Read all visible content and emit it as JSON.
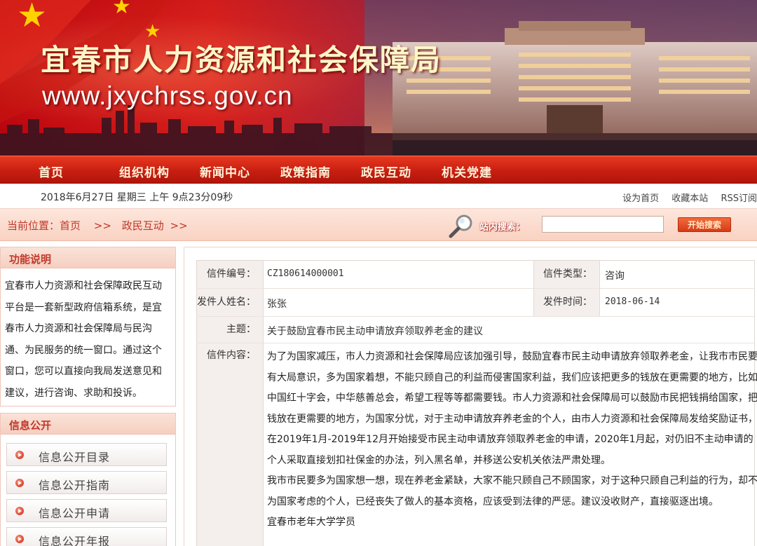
{
  "banner": {
    "title": "宜春市人力资源和社会保障局",
    "url": "www.jxychrss.gov.cn"
  },
  "nav": {
    "items": [
      "首页",
      "组织机构",
      "新闻中心",
      "政策指南",
      "政民互动",
      "机关党建"
    ]
  },
  "datebar": {
    "date": "2018年6月27日 星期三  上午 9点23分09秒",
    "links": [
      "设为首页",
      "收藏本站",
      "RSS订阅"
    ]
  },
  "location": {
    "label": "当前位置：首页",
    "sep1": ">>",
    "section": "政民互动",
    "sep2": ">>",
    "search_label": "站内搜索：",
    "search_value": "",
    "search_button": "开始搜索"
  },
  "sidebar": {
    "func_title": "功能说明",
    "func_text": "宜春市人力资源和社会保障政民互动平台是一套新型政府信箱系统，是宜春市人力资源和社会保障局与民沟通、为民服务的统一窗口。通过这个窗口，您可以直接向我局发送意见和建议，进行咨询、求助和投诉。",
    "info_title": "信息公开",
    "info_items": [
      "信息公开目录",
      "信息公开指南",
      "信息公开申请",
      "信息公开年报"
    ]
  },
  "letter": {
    "id_label": "信件编号：",
    "id": "CZ180614000001",
    "type_label": "信件类型：",
    "type": "咨询",
    "sender_label": "发件人姓名：",
    "sender": "张张",
    "time_label": "发件时间：",
    "time": "2018-06-14",
    "subject_label": "主题：",
    "subject": "关于鼓励宜春市民主动申请放弃领取养老金的建议",
    "content_label": "信件内容：",
    "content_p1": "为了为国家减压，市人力资源和社会保障局应该加强引导，鼓励宜春市民主动申请放弃领取养老金，让我市市民要有大局意识，多为国家着想，不能只顾自己的利益而侵害国家利益，我们应该把更多的钱放在更需要的地方，比如中国红十字会，中华慈善总会，希望工程等等都需要钱。市人力资源和社会保障局可以鼓励市民把钱捐给国家，把钱放在更需要的地方，为国家分忧，对于主动申请放弃养老金的个人，由市人力资源和社会保障局发给奖励证书，在2019年1月-2019年12月开始接受市民主动申请放弃领取养老金的申请，2020年1月起，对仍旧不主动申请的个人采取直接划扣社保金的办法，列入黑名单，并移送公安机关依法严肃处理。",
    "content_p2": "我市市民要多为国家想一想，现在养老金紧缺，大家不能只顾自己不顾国家，对于这种只顾自己利益的行为，却不为国家考虑的个人，已经丧失了做人的基本资格，应该受到法律的严惩。建议没收财产，直接驱逐出境。",
    "content_sign": "宜春市老年大学学员"
  }
}
